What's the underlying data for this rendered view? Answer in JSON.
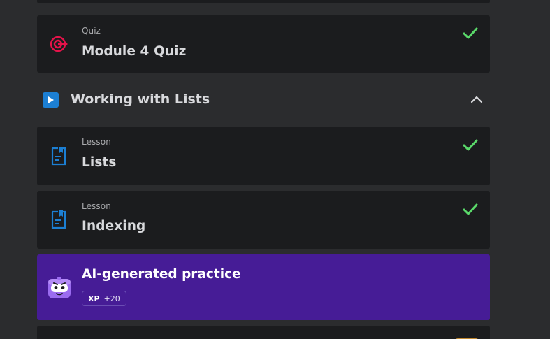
{
  "course": {
    "module_quiz": {
      "type_label": "Quiz",
      "title": "Module 4 Quiz",
      "completed": true
    },
    "section": {
      "title": "Working with Lists",
      "expanded": true
    },
    "lessons": [
      {
        "type_label": "Lesson",
        "title": "Lists",
        "completed": true
      },
      {
        "type_label": "Lesson",
        "title": "Indexing",
        "completed": true
      }
    ],
    "ai_practice": {
      "title": "AI-generated practice",
      "xp_label": "XP",
      "xp_value": "+20"
    }
  },
  "colors": {
    "page_bg": "#2b2c2e",
    "card_bg": "#1b1c1e",
    "check_green": "#5ad96a",
    "quiz_icon": "#e5134a",
    "lesson_icon": "#1c7fd3",
    "ai_card_bg": "#461c96"
  },
  "icons": {
    "quiz": "target-icon",
    "lesson": "document-icon",
    "section": "play-icon",
    "collapse": "chevron-up-icon",
    "complete": "checkmark-icon",
    "ai": "robot-avatar-icon"
  }
}
